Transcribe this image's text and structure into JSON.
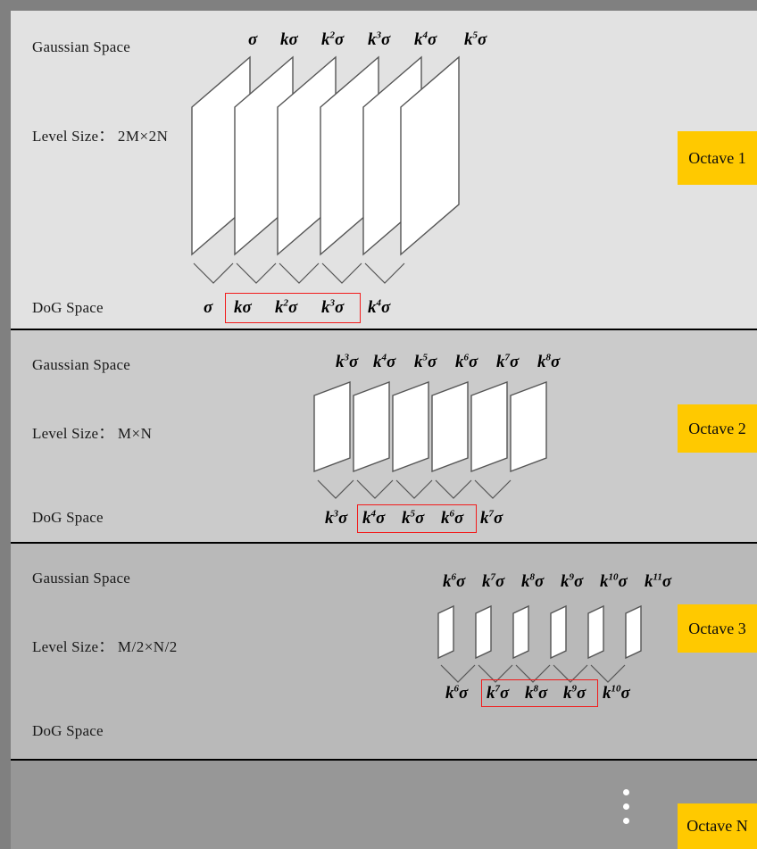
{
  "figure": {
    "title": "SIFT scale-space octave diagram",
    "background_color": "#808080",
    "accent_color": "#FFC900",
    "highlight_color": "#F21B1B"
  },
  "row_labels": {
    "gaussian_space": "Gaussian Space",
    "dog_space": "DoG Space",
    "level_size_prefix": "Level Size："
  },
  "octaves": [
    {
      "tag": "Octave 1",
      "level_size": "2M×2N",
      "gaussian_labels": [
        "σ",
        "kσ",
        "k²σ",
        "k³σ",
        "k⁴σ",
        "k⁵σ"
      ],
      "gaussian_exponents": [
        "",
        "",
        "2",
        "3",
        "4",
        "5"
      ],
      "dog_labels": [
        "σ",
        "kσ",
        "k²σ",
        "k³σ",
        "k⁴σ"
      ],
      "dog_exponents": [
        "",
        "",
        "2",
        "3",
        "4"
      ],
      "dog_highlighted": [
        "kσ",
        "k²σ",
        "k³σ"
      ]
    },
    {
      "tag": "Octave 2",
      "level_size": "M×N",
      "gaussian_labels": [
        "k³σ",
        "k⁴σ",
        "k⁵σ",
        "k⁶σ",
        "k⁷σ",
        "k⁸σ"
      ],
      "gaussian_exponents": [
        "3",
        "4",
        "5",
        "6",
        "7",
        "8"
      ],
      "dog_labels": [
        "k³σ",
        "k⁴σ",
        "k⁵σ",
        "k⁶σ",
        "k⁷σ"
      ],
      "dog_exponents": [
        "3",
        "4",
        "5",
        "6",
        "7"
      ],
      "dog_highlighted": [
        "k⁴σ",
        "k⁵σ",
        "k⁶σ"
      ]
    },
    {
      "tag": "Octave 3",
      "level_size": "M/2×N/2",
      "gaussian_labels": [
        "k⁶σ",
        "k⁷σ",
        "k⁸σ",
        "k⁹σ",
        "k¹⁰σ",
        "k¹¹σ"
      ],
      "gaussian_exponents": [
        "6",
        "7",
        "8",
        "9",
        "10",
        "11"
      ],
      "dog_labels": [
        "k⁶σ",
        "k⁷σ",
        "k⁸σ",
        "k⁹σ",
        "k¹⁰σ"
      ],
      "dog_exponents": [
        "6",
        "7",
        "8",
        "9",
        "10"
      ],
      "dog_highlighted": [
        "k⁷σ",
        "k⁸σ",
        "k⁹σ"
      ]
    },
    {
      "tag": "Octave N",
      "level_size": "",
      "gaussian_labels": [],
      "gaussian_exponents": [],
      "dog_labels": [],
      "dog_exponents": [],
      "dog_highlighted": []
    }
  ],
  "glyphs": {
    "sigma": "σ",
    "k": "k",
    "ellipsis": "vertical-ellipsis"
  }
}
